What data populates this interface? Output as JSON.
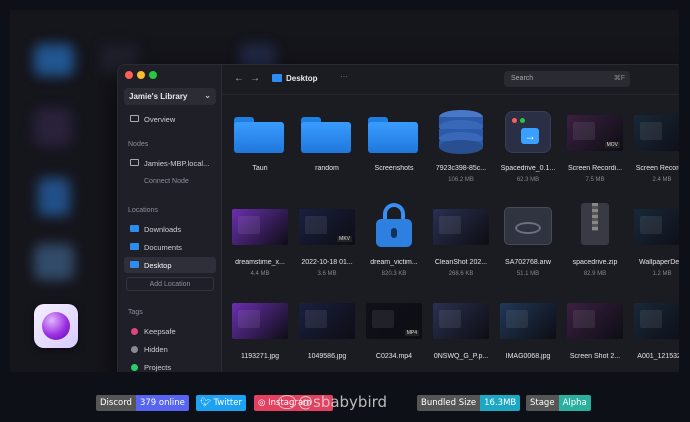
{
  "sidebar": {
    "library": "Jamie's Library",
    "overview": "Overview",
    "nodes_heading": "Nodes",
    "node": "Jamies-MBP.local...",
    "connect_node": "Connect Node",
    "locations_heading": "Locations",
    "locations": [
      "Downloads",
      "Documents",
      "Desktop"
    ],
    "add_location": "Add Location",
    "tags_heading": "Tags",
    "tags": [
      {
        "label": "Keepsafe",
        "color": "#e0457b"
      },
      {
        "label": "Hidden",
        "color": "#8a8a95"
      },
      {
        "label": "Projects",
        "color": "#2ecc71"
      }
    ]
  },
  "toolbar": {
    "back": "←",
    "forward": "→",
    "current": "Desktop",
    "more": "···",
    "search_placeholder": "Search",
    "search_shortcut": "⌘F"
  },
  "files": [
    {
      "name": "Tauri",
      "size": "",
      "kind": "folder"
    },
    {
      "name": "random",
      "size": "",
      "kind": "folder"
    },
    {
      "name": "Screenshots",
      "size": "",
      "kind": "folder"
    },
    {
      "name": "7923c398-85c...",
      "size": "106.2 MB",
      "kind": "database"
    },
    {
      "name": "Spacedrive_0.1...",
      "size": "62.3 MB",
      "kind": "app"
    },
    {
      "name": "Screen Recordi...",
      "size": "7.5 MB",
      "kind": "video",
      "badge": "MOV"
    },
    {
      "name": "Screen Record...",
      "size": "2.4 MB",
      "kind": "video"
    },
    {
      "name": "dreamstime_x...",
      "size": "4.4 MB",
      "kind": "image"
    },
    {
      "name": "2022-10-18 01...",
      "size": "3.6 MB",
      "kind": "video",
      "badge": "MKV"
    },
    {
      "name": "dream_victim...",
      "size": "820.3 KB",
      "kind": "locked"
    },
    {
      "name": "CleanShot 202...",
      "size": "268.6 KB",
      "kind": "image"
    },
    {
      "name": "SA702768.arw",
      "size": "51.1 MB",
      "kind": "raw"
    },
    {
      "name": "spacedrive.zip",
      "size": "82.9 MB",
      "kind": "zip"
    },
    {
      "name": "WallpaperDe...",
      "size": "1.2 MB",
      "kind": "image"
    },
    {
      "name": "1193271.jpg",
      "size": "",
      "kind": "image"
    },
    {
      "name": "1049586.jpg",
      "size": "",
      "kind": "image"
    },
    {
      "name": "C0234.mp4",
      "size": "",
      "kind": "video",
      "badge": "MP4"
    },
    {
      "name": "0NSWQ_G_P.p...",
      "size": "",
      "kind": "image"
    },
    {
      "name": "IMAG0068.jpg",
      "size": "",
      "kind": "image"
    },
    {
      "name": "Screen Shot 2...",
      "size": "",
      "kind": "image"
    },
    {
      "name": "A001_121532...",
      "size": "",
      "kind": "image"
    }
  ],
  "badges": [
    {
      "key": "Discord",
      "value": "379 online",
      "color": "#5865f2"
    },
    {
      "key": "Twitter",
      "value": "Twitter",
      "color": "#1da1f2"
    },
    {
      "key": "Instagram",
      "value": "",
      "color": "#e4405f"
    },
    {
      "key": "Bundled Size",
      "value": "16.3MB",
      "color": "#1ea7c5"
    },
    {
      "key": "Stage",
      "value": "Alpha",
      "color": "#2bb0a0"
    }
  ],
  "watermark": "@sbabybird"
}
